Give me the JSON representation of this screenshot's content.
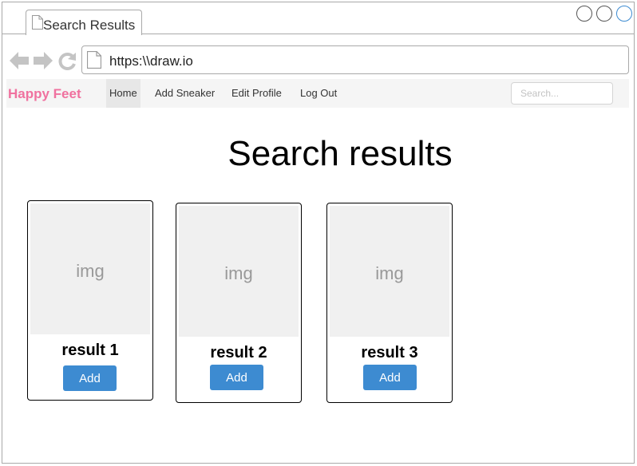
{
  "browser": {
    "tab_title": "Search Results",
    "url": "https:\\\\draw.io"
  },
  "navbar": {
    "brand": "Happy Feet",
    "brand_color": "#f0719f",
    "links": [
      {
        "label": "Home",
        "active": true
      },
      {
        "label": "Add Sneaker",
        "active": false
      },
      {
        "label": "Edit Profile",
        "active": false
      },
      {
        "label": "Log Out",
        "active": false
      }
    ],
    "search_placeholder": "Search..."
  },
  "main": {
    "title": "Search results",
    "results": [
      {
        "image_label": "img",
        "title": "result 1",
        "button": "Add"
      },
      {
        "image_label": "img",
        "title": "result 2",
        "button": "Add"
      },
      {
        "image_label": "img",
        "title": "result 3",
        "button": "Add"
      }
    ],
    "button_color": "#3d8bd1"
  },
  "icons": [
    "back-icon",
    "forward-icon",
    "reload-icon",
    "document-icon"
  ]
}
